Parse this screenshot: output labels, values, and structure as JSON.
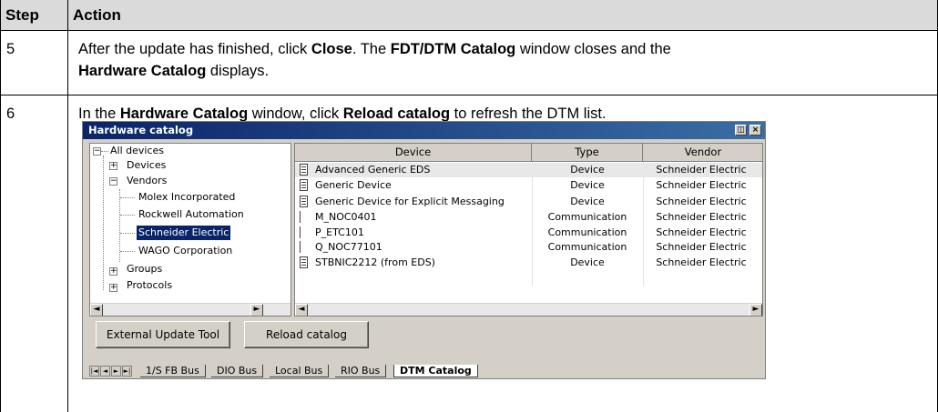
{
  "table": {
    "header": {
      "step": "Step",
      "action": "Action"
    },
    "rows": [
      {
        "step": "5",
        "line1": [
          "After the update has finished, click ",
          "Close",
          ". The ",
          "FDT/DTM Catalog",
          " window closes and the"
        ],
        "line2": [
          "Hardware Catalog",
          " displays."
        ]
      },
      {
        "step": "6",
        "line1": [
          "In the ",
          "Hardware Catalog",
          " window, click ",
          "Reload catalog",
          " to refresh the DTM list."
        ]
      }
    ]
  },
  "window": {
    "title": "Hardware catalog",
    "tree": [
      {
        "label": "All devices",
        "expander": "−"
      },
      {
        "label": "Devices",
        "expander": "+"
      },
      {
        "label": "Vendors",
        "expander": "−"
      },
      {
        "label": "Molex Incorporated"
      },
      {
        "label": "Rockwell Automation"
      },
      {
        "label": "Schneider Electric",
        "selected": true
      },
      {
        "label": "WAGO Corporation"
      },
      {
        "label": "Groups",
        "expander": "+"
      },
      {
        "label": "Protocols",
        "expander": "+"
      }
    ],
    "columns": {
      "device": "Device",
      "type": "Type",
      "vendor": "Vendor"
    },
    "rows": [
      {
        "device": "Advanced Generic EDS",
        "type": "Device",
        "vendor": "Schneider Electric",
        "icon": "device-icon"
      },
      {
        "device": "Generic Device",
        "type": "Device",
        "vendor": "Schneider Electric",
        "icon": "device-icon"
      },
      {
        "device": "Generic Device for Explicit Messaging",
        "type": "Device",
        "vendor": "Schneider Electric",
        "icon": "device-icon"
      },
      {
        "device": "M_NOC0401",
        "type": "Communication",
        "vendor": "Schneider Electric",
        "icon": "communication-icon"
      },
      {
        "device": "P_ETC101",
        "type": "Communication",
        "vendor": "Schneider Electric",
        "icon": "communication-icon"
      },
      {
        "device": "Q_NOC77101",
        "type": "Communication",
        "vendor": "Schneider Electric",
        "icon": "communication-icon"
      },
      {
        "device": "STBNIC2212 (from EDS)",
        "type": "Device",
        "vendor": "Schneider Electric",
        "icon": "device-icon"
      }
    ],
    "buttons": {
      "external": "External Update Tool",
      "reload": "Reload catalog"
    },
    "tabs": [
      "1/S FB Bus",
      "DIO Bus",
      "Local Bus",
      "RIO Bus",
      "DTM Catalog"
    ],
    "active_tab": "DTM Catalog",
    "scroll_glyphs": {
      "left": "◄",
      "right": "►"
    },
    "nav_glyphs": [
      "|◄",
      "◄",
      "►",
      "►|"
    ],
    "title_buttons": [
      "◫",
      "×"
    ]
  }
}
